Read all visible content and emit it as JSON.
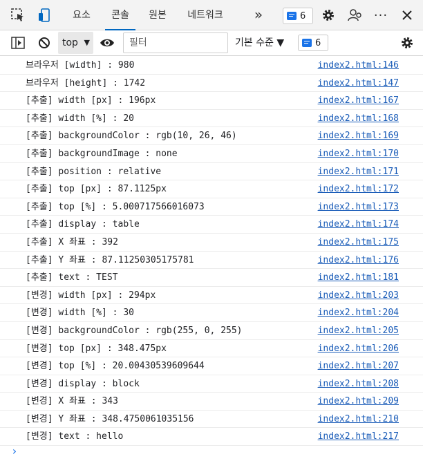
{
  "tabs": [
    {
      "label": "요소"
    },
    {
      "label": "콘솔"
    },
    {
      "label": "원본"
    },
    {
      "label": "네트워크"
    }
  ],
  "more_tabs": "»",
  "issues_count": "6",
  "toolbar": {
    "context": "top",
    "filter_placeholder": "필터",
    "levels": "기본 수준 ▼",
    "issues_count": "6"
  },
  "logs": [
    {
      "msg": "브라우저 [width] : 980",
      "src": "index2.html:146"
    },
    {
      "msg": "브라우저 [height] : 1742",
      "src": "index2.html:147"
    },
    {
      "msg": "[추출] width [px] : 196px",
      "src": "index2.html:167"
    },
    {
      "msg": "[추출] width [%] : 20",
      "src": "index2.html:168"
    },
    {
      "msg": "[추출] backgroundColor : rgb(10, 26, 46)",
      "src": "index2.html:169"
    },
    {
      "msg": "[추출] backgroundImage : none",
      "src": "index2.html:170"
    },
    {
      "msg": "[추출] position : relative",
      "src": "index2.html:171"
    },
    {
      "msg": "[추출] top [px] : 87.1125px",
      "src": "index2.html:172"
    },
    {
      "msg": "[추출] top [%] : 5.000717566016073",
      "src": "index2.html:173"
    },
    {
      "msg": "[추출] display : table",
      "src": "index2.html:174"
    },
    {
      "msg": "[추출] X 좌표 : 392",
      "src": "index2.html:175"
    },
    {
      "msg": "[추출] Y 좌표 : 87.11250305175781",
      "src": "index2.html:176"
    },
    {
      "msg": "[추출] text : TEST",
      "src": "index2.html:181"
    },
    {
      "msg": "[변경] width [px] : 294px",
      "src": "index2.html:203"
    },
    {
      "msg": "[변경] width [%] : 30",
      "src": "index2.html:204"
    },
    {
      "msg": "[변경] backgroundColor : rgb(255, 0, 255)",
      "src": "index2.html:205"
    },
    {
      "msg": "[변경] top [px] : 348.475px",
      "src": "index2.html:206"
    },
    {
      "msg": "[변경] top [%] : 20.00430539609644",
      "src": "index2.html:207"
    },
    {
      "msg": "[변경] display : block",
      "src": "index2.html:208"
    },
    {
      "msg": "[변경] X 좌표 : 343",
      "src": "index2.html:209"
    },
    {
      "msg": "[변경] Y 좌표 : 348.4750061035156",
      "src": "index2.html:210"
    },
    {
      "msg": "[변경] text : hello",
      "src": "index2.html:217"
    }
  ],
  "prompt_symbol": "›",
  "colors": {
    "accent": "#0067c0",
    "link": "#1a5cb8",
    "badge": "#1a73e8"
  }
}
